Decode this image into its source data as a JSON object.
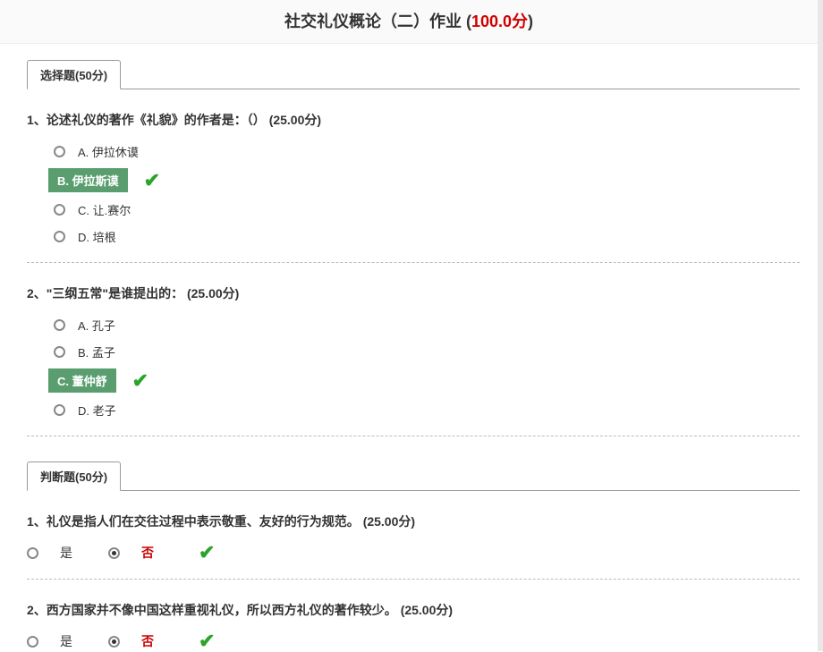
{
  "header": {
    "title_prefix": "社交礼仪概论（二）作业 (",
    "score": "100.0分",
    "title_suffix": ")"
  },
  "section_choice": {
    "tab_label": "选择题(50分)",
    "questions": [
      {
        "number": "1、",
        "text": "论述礼仪的著作《礼貌》的作者是：（）",
        "points": "(25.00分)",
        "options": [
          {
            "letter": "A.",
            "text": "伊拉休谟",
            "correct": false
          },
          {
            "letter": "B.",
            "text": "伊拉斯谟",
            "correct": true
          },
          {
            "letter": "C.",
            "text": "让.赛尔",
            "correct": false
          },
          {
            "letter": "D.",
            "text": "培根",
            "correct": false
          }
        ]
      },
      {
        "number": "2、",
        "text": "\"三纲五常\"是谁提出的：",
        "points": "(25.00分)",
        "options": [
          {
            "letter": "A.",
            "text": "孔子",
            "correct": false
          },
          {
            "letter": "B.",
            "text": "孟子",
            "correct": false
          },
          {
            "letter": "C.",
            "text": "董仲舒",
            "correct": true
          },
          {
            "letter": "D.",
            "text": "老子",
            "correct": false
          }
        ]
      }
    ]
  },
  "section_tf": {
    "tab_label": "判断题(50分)",
    "labels": {
      "true": "是",
      "false": "否"
    },
    "questions": [
      {
        "number": "1、",
        "text": "礼仪是指人们在交往过程中表示敬重、友好的行为规范。",
        "points": "(25.00分)",
        "selected": "false",
        "correct": true
      },
      {
        "number": "2、",
        "text": "西方国家并不像中国这样重视礼仪，所以西方礼仪的著作较少。",
        "points": "(25.00分)",
        "selected": "false",
        "correct": true
      }
    ]
  }
}
